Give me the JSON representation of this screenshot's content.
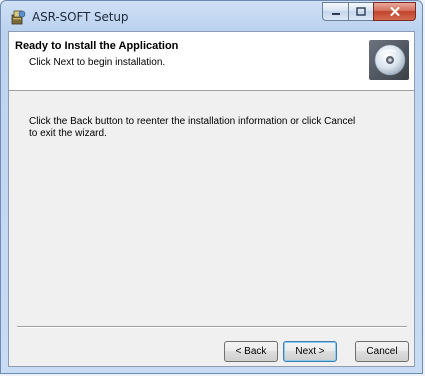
{
  "window": {
    "title": "ASR-SOFT Setup",
    "controls": {
      "minimize": "minimize-icon",
      "maximize": "maximize-icon",
      "close": "close-icon"
    }
  },
  "header": {
    "title": "Ready to Install the Application",
    "subtitle": "Click Next to begin installation.",
    "icon": "disc-icon"
  },
  "body": {
    "text": "Click the Back button to reenter the installation information or click Cancel to exit the wizard."
  },
  "buttons": {
    "back": "< Back",
    "next": "Next >",
    "cancel": "Cancel"
  },
  "colors": {
    "frame": "#c8dcf3",
    "close_button": "#c0432d",
    "default_button_border": "#3c7fb1"
  }
}
